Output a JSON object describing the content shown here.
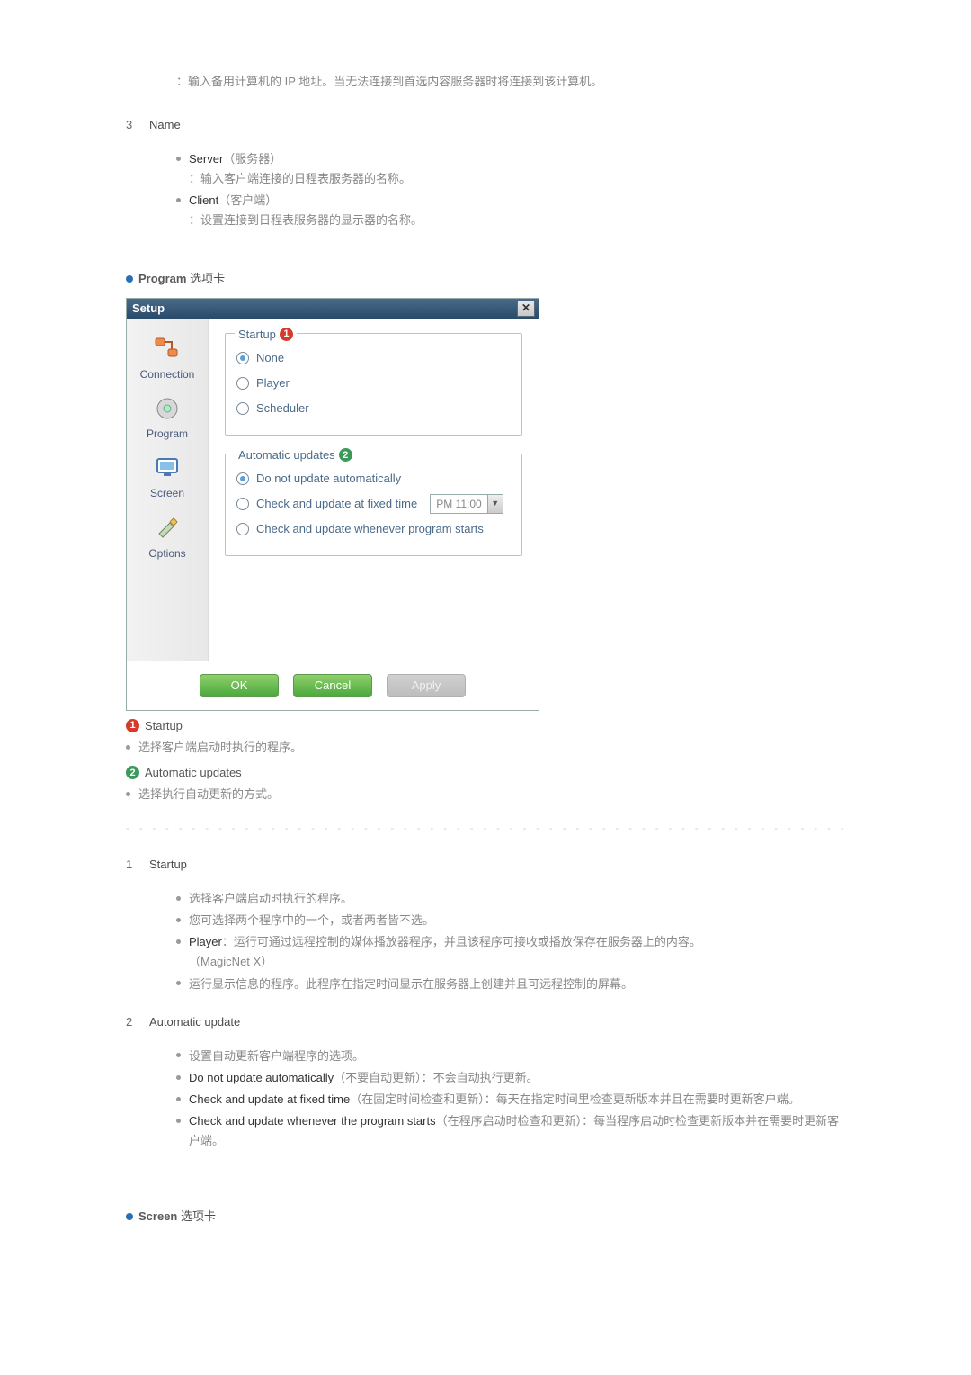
{
  "intro_note": "：输入备用计算机的 IP 地址。当无法连接到首选内容服务器时将连接到该计算机。",
  "name_section": {
    "num": "3",
    "title": "Name",
    "server_label": "Server",
    "server_paren": "（服务器）",
    "server_desc": "：输入客户端连接的日程表服务器的名称。",
    "client_label": "Client",
    "client_paren": "（客户端）",
    "client_desc": "：设置连接到日程表服务器的显示器的名称。"
  },
  "program_tab": {
    "head_bold": "Program",
    "head_rest": " 选项卡"
  },
  "dialog": {
    "title": "Setup",
    "sidebar": {
      "connection": "Connection",
      "program": "Program",
      "screen": "Screen",
      "options": "Options"
    },
    "startup": {
      "legend": "Startup",
      "badge": "1",
      "none": "None",
      "player": "Player",
      "scheduler": "Scheduler"
    },
    "auto": {
      "legend": "Automatic updates",
      "badge": "2",
      "opt1": "Do not update automatically",
      "opt2": "Check and update at fixed time",
      "time": "PM 11:00",
      "opt3": "Check and update whenever program starts"
    },
    "buttons": {
      "ok": "OK",
      "cancel": "Cancel",
      "apply": "Apply"
    }
  },
  "callouts": {
    "c1_title": "Startup",
    "c1_desc": "选择客户端启动时执行的程序。",
    "c2_title": "Automatic updates",
    "c2_desc": "选择执行自动更新的方式。"
  },
  "detail1": {
    "num": "1",
    "title": "Startup",
    "li1": "选择客户端启动时执行的程序。",
    "li2": "您可选择两个程序中的一个，或者两者皆不选。",
    "li3a": "Player",
    "li3b": "：运行可通过远程控制的媒体播放器程序，并且该程序可接收或播放保存在服务器上的内容。",
    "li3c": "（MagicNet X）",
    "li4": "运行显示信息的程序。此程序在指定时间显示在服务器上创建并且可远程控制的屏幕。"
  },
  "detail2": {
    "num": "2",
    "title": "Automatic update",
    "li1": "设置自动更新客户端程序的选项。",
    "li2a": "Do not update automatically",
    "li2b": "（不要自动更新）：不会自动执行更新。",
    "li3a": "Check and update at fixed time",
    "li3b": "（在固定时间检查和更新）：每天在指定时间里检查更新版本并且在需要时更新客户端。",
    "li4a": "Check and update whenever the program starts",
    "li4b": "（在程序启动时检查和更新）：每当程序启动时检查更新版本并在需要时更新客户端。"
  },
  "screen_tab": {
    "head_bold": "Screen",
    "head_rest": " 选项卡"
  }
}
